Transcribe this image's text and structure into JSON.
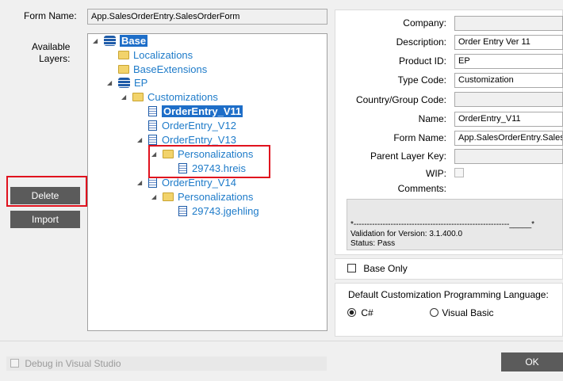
{
  "form_name": {
    "label": "Form Name:",
    "value": "App.SalesOrderEntry.SalesOrderForm"
  },
  "layers_label": "Available\nLayers:",
  "tree": {
    "base": "Base",
    "localizations": "Localizations",
    "base_extensions": "BaseExtensions",
    "ep": "EP",
    "customizations": "Customizations",
    "oe_v11": "OrderEntry_V11",
    "oe_v12": "OrderEntry_V12",
    "oe_v13": "OrderEntry_V13",
    "pers_v13": "Personalizations",
    "hreis": "29743.hreis",
    "oe_v14": "OrderEntry_V14",
    "pers_v14": "Personalizations",
    "jgehling": "29743.jgehling"
  },
  "buttons": {
    "delete": "Delete",
    "import": "Import",
    "ok": "OK"
  },
  "details": {
    "company": {
      "label": "Company:",
      "value": ""
    },
    "description": {
      "label": "Description:",
      "value": "Order Entry Ver 11"
    },
    "product_id": {
      "label": "Product ID:",
      "value": "EP"
    },
    "type_code": {
      "label": "Type Code:",
      "value": "Customization"
    },
    "country_group": {
      "label": "Country/Group Code:",
      "value": ""
    },
    "name": {
      "label": "Name:",
      "value": "OrderEntry_V11"
    },
    "form_name": {
      "label": "Form Name:",
      "value": "App.SalesOrderEntry.SalesOrderForm"
    },
    "parent_layer_key": {
      "label": "Parent Layer Key:",
      "value": ""
    },
    "wip": {
      "label": "WIP:"
    },
    "comments": {
      "label": "Comments:"
    }
  },
  "comments_box": {
    "dashes": "*-----------------------------------------------------------_____*",
    "validation": "Validation for Version: 3.1.400.0",
    "status": "Status: Pass"
  },
  "base_only": "Base Only",
  "language": {
    "label": "Default Customization Programming Language:",
    "options": [
      "C#",
      "Visual Basic"
    ],
    "selected": "C#"
  },
  "debug": "Debug in Visual Studio"
}
